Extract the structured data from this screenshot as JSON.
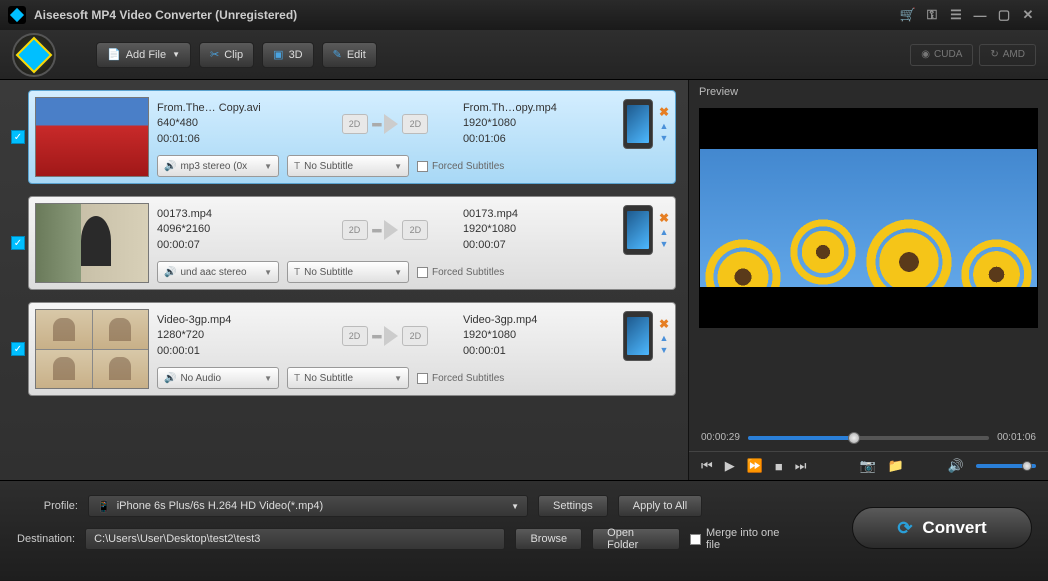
{
  "title": "Aiseesoft MP4 Video Converter (Unregistered)",
  "toolbar": {
    "add_file": "Add File",
    "clip": "Clip",
    "three_d": "3D",
    "edit": "Edit",
    "cuda": "CUDA",
    "amd": "AMD"
  },
  "files": [
    {
      "src_name": "From.The… Copy.avi",
      "src_res": "640*480",
      "src_dur": "00:01:06",
      "dst_name": "From.Th…opy.mp4",
      "dst_res": "1920*1080",
      "dst_dur": "00:01:06",
      "audio": "mp3 stereo (0x",
      "subtitle": "No Subtitle",
      "forced": "Forced Subtitles",
      "selected": true
    },
    {
      "src_name": "00173.mp4",
      "src_res": "4096*2160",
      "src_dur": "00:00:07",
      "dst_name": "00173.mp4",
      "dst_res": "1920*1080",
      "dst_dur": "00:00:07",
      "audio": "und aac stereo",
      "subtitle": "No Subtitle",
      "forced": "Forced Subtitles",
      "selected": false
    },
    {
      "src_name": "Video-3gp.mp4",
      "src_res": "1280*720",
      "src_dur": "00:00:01",
      "dst_name": "Video-3gp.mp4",
      "dst_res": "1920*1080",
      "dst_dur": "00:00:01",
      "audio": "No Audio",
      "subtitle": "No Subtitle",
      "forced": "Forced Subtitles",
      "selected": false
    }
  ],
  "preview": {
    "title": "Preview",
    "time_current": "00:00:29",
    "time_total": "00:01:06"
  },
  "profile": {
    "label": "Profile:",
    "value": "iPhone 6s Plus/6s H.264 HD Video(*.mp4)",
    "settings": "Settings",
    "apply_all": "Apply to All"
  },
  "destination": {
    "label": "Destination:",
    "value": "C:\\Users\\User\\Desktop\\test2\\test3",
    "browse": "Browse",
    "open_folder": "Open Folder",
    "merge": "Merge into one file"
  },
  "convert": "Convert"
}
